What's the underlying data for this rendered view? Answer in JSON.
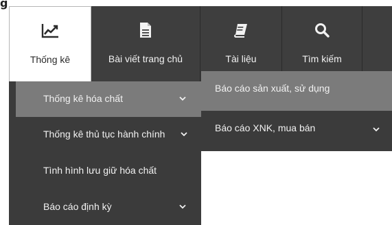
{
  "corner_mark": "g",
  "nav": {
    "items": [
      {
        "label": "Thống kê",
        "icon": "line-chart-icon",
        "active": true
      },
      {
        "label": "Bài viết trang chủ",
        "icon": "document-icon"
      },
      {
        "label": "Tài liệu",
        "icon": "book-icon"
      },
      {
        "label": "Tìm kiếm",
        "icon": "search-icon"
      }
    ]
  },
  "submenu": {
    "items": [
      {
        "label": "Thống kê hóa chất",
        "has_children": true,
        "highlighted": true
      },
      {
        "label": "Thống kê thủ tục hành chính",
        "has_children": true
      },
      {
        "label": "Tình hình lưu giữ hóa chất",
        "has_children": false
      },
      {
        "label": "Báo cáo định kỳ",
        "has_children": true
      }
    ]
  },
  "flyout": {
    "items": [
      {
        "label": "Báo cáo sản xuất, sử dụng",
        "has_children": false,
        "highlighted": true
      },
      {
        "label": "Báo cáo XNK, mua bán",
        "has_children": true
      }
    ]
  },
  "colors": {
    "navbar_bg": "#3e3e3e",
    "menu_bg": "#3b3b3b",
    "highlight_bg": "#7b7b7b",
    "text_light": "#f2f2f2"
  }
}
